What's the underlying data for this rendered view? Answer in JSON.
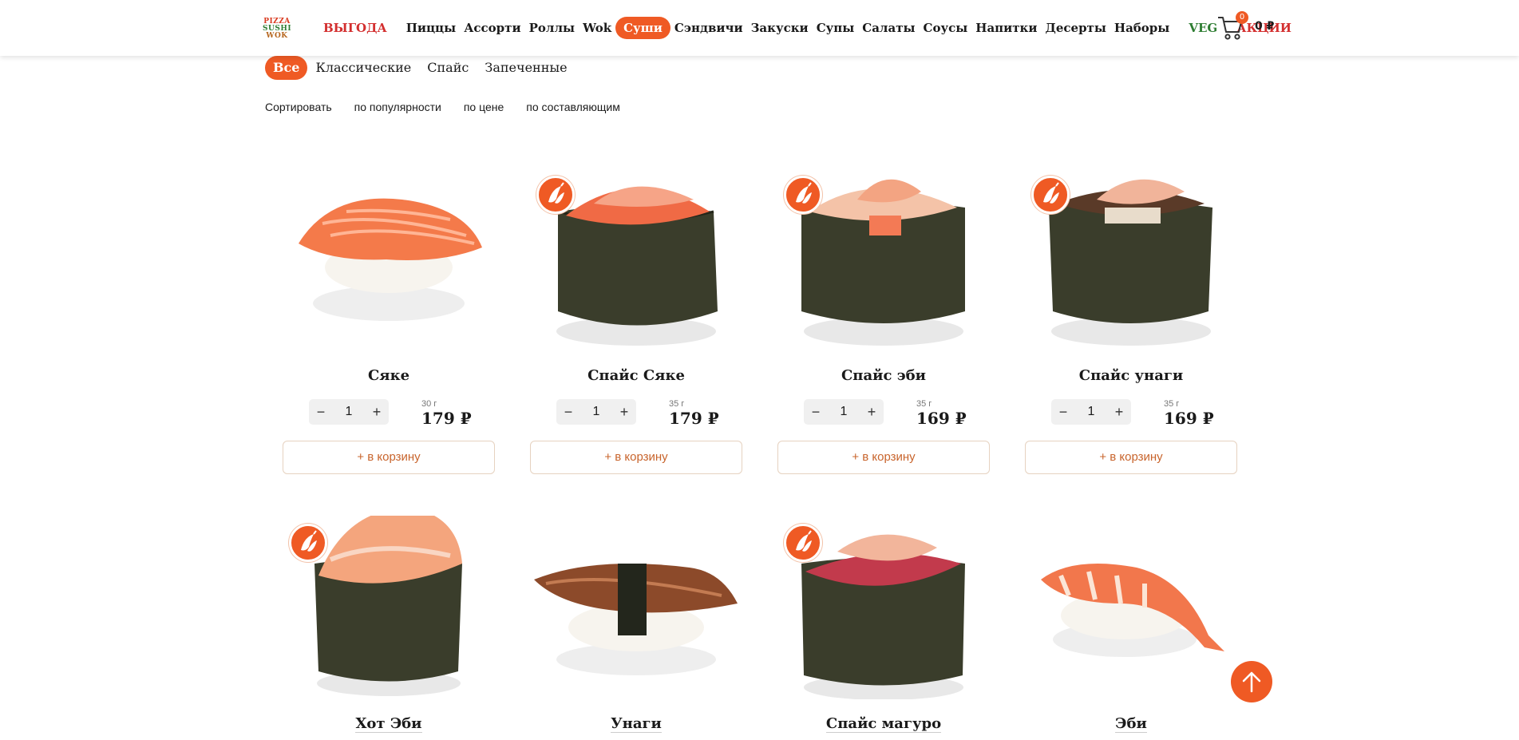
{
  "header": {
    "logo": [
      "PIZZA",
      "SUSHI",
      "WOK"
    ],
    "nav": [
      {
        "label": "ВЫГОДА",
        "style": "red"
      },
      {
        "label": "Пиццы"
      },
      {
        "label": "Ассорти"
      },
      {
        "label": "Роллы"
      },
      {
        "label": "Wok"
      },
      {
        "label": "Суши",
        "active": true
      },
      {
        "label": "Сэндвичи"
      },
      {
        "label": "Закуски"
      },
      {
        "label": "Супы"
      },
      {
        "label": "Салаты"
      },
      {
        "label": "Соусы"
      },
      {
        "label": "Напитки"
      },
      {
        "label": "Десерты"
      },
      {
        "label": "Наборы"
      },
      {
        "label": "VEG",
        "style": "green"
      },
      {
        "label": "АКЦИИ",
        "style": "red"
      }
    ],
    "cart_count": "0",
    "cart_sum": "0 ₽"
  },
  "filters": [
    "Все",
    "Классические",
    "Спайс",
    "Запеченные"
  ],
  "sort": {
    "label": "Сортировать",
    "options": [
      "по популярности",
      "по цене",
      "по составляющим"
    ]
  },
  "products": [
    {
      "name": "Сяке",
      "weight": "30 г",
      "price": "179 ₽",
      "qty": "1",
      "add": "+ в корзину",
      "spicy": false,
      "type": "nigiri-salmon"
    },
    {
      "name": "Спайс Сяке",
      "weight": "35 г",
      "price": "179 ₽",
      "qty": "1",
      "add": "+ в корзину",
      "spicy": true,
      "type": "gunkan-salmon"
    },
    {
      "name": "Спайс эби",
      "weight": "35 г",
      "price": "169 ₽",
      "qty": "1",
      "add": "+ в корзину",
      "spicy": true,
      "type": "gunkan-shrimp"
    },
    {
      "name": "Спайс унаги",
      "weight": "35 г",
      "price": "169 ₽",
      "qty": "1",
      "add": "+ в корзину",
      "spicy": true,
      "type": "gunkan-eel"
    }
  ],
  "products_row2": [
    {
      "name": "Хот Эби",
      "spicy": true,
      "type": "gunkan-hot"
    },
    {
      "name": "Унаги",
      "spicy": false,
      "type": "nigiri-eel"
    },
    {
      "name": "Спайс магуро",
      "spicy": true,
      "type": "gunkan-tuna"
    },
    {
      "name": "Эби",
      "spicy": false,
      "type": "nigiri-shrimp"
    }
  ],
  "icons": {
    "spicy": "pepper-icon",
    "cart": "cart-icon",
    "to_top": "arrow-up-icon"
  },
  "colors": {
    "accent": "#ef5a24",
    "red": "#d32f2f",
    "green": "#2e7d32"
  }
}
